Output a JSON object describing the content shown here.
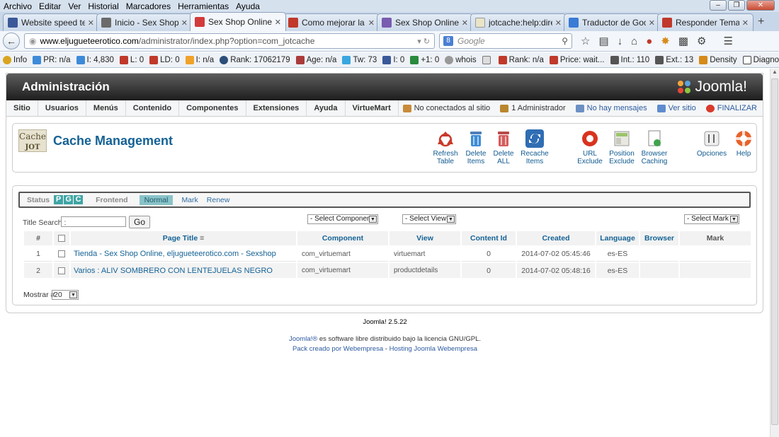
{
  "browser": {
    "menu": [
      "Archivo",
      "Editar",
      "Ver",
      "Historial",
      "Marcadores",
      "Herramientas",
      "Ayuda"
    ],
    "tabs": [
      {
        "title": "Website speed test",
        "color": "#3b5998"
      },
      {
        "title": "Inicio - Sex Shop ...",
        "color": "#6b6b6b"
      },
      {
        "title": "Sex Shop Online. ...",
        "color": "#d23b3b"
      },
      {
        "title": "Como mejorar la ...",
        "color": "#c0392b"
      },
      {
        "title": "Sex Shop Online. ...",
        "color": "#7a5cb0"
      },
      {
        "title": "jotcache:help:dire...",
        "color": "#f2f0e0"
      },
      {
        "title": "Traductor de Goo...",
        "color": "#3a7bd5"
      },
      {
        "title": "Responder Tema: ...",
        "color": "#c0392b"
      }
    ],
    "url_domain": "www.eljugueteerotico.com",
    "url_path": "/administrator/index.php?option=com_jotcache",
    "search_placeholder": "Google",
    "seo": [
      "Info",
      "PR: n/a",
      "I: 4,830",
      "L: 0",
      "LD: 0",
      "I: n/a",
      "Rank: 17062179",
      "Age: n/a",
      "Tw: 73",
      "I: 0",
      "+1: 0",
      "whois",
      "",
      "Rank: n/a",
      "Price: wait...",
      "Int.: 110",
      "Ext.: 13",
      "Density",
      "Diagnosis"
    ]
  },
  "admin": {
    "title": "Administración",
    "brand": "Joomla!",
    "menu": [
      "Sitio",
      "Usuarios",
      "Menús",
      "Contenido",
      "Componentes",
      "Extensiones",
      "Ayuda",
      "VirtueMart"
    ],
    "status": {
      "not_connected": "No conectados al sitio",
      "admins": "1 Administrador",
      "messages": "No hay mensajes",
      "view_site": "Ver sitio",
      "logout": "FINALIZAR"
    }
  },
  "toolbar": {
    "logo_line1": "Cache",
    "logo_line2": "JOT",
    "title": "Cache Management",
    "buttons": [
      {
        "l1": "Refresh",
        "l2": "Table"
      },
      {
        "l1": "Delete",
        "l2": "Items"
      },
      {
        "l1": "Delete",
        "l2": "ALL"
      },
      {
        "l1": "Recache",
        "l2": "Items"
      },
      {
        "l1": "URL",
        "l2": "Exclude"
      },
      {
        "l1": "Position",
        "l2": "Exclude"
      },
      {
        "l1": "Browser",
        "l2": "Caching"
      },
      {
        "l1": "Opciones",
        "l2": ""
      },
      {
        "l1": "Help",
        "l2": ""
      }
    ]
  },
  "filters": {
    "status_label": "Status",
    "pgc": [
      "P",
      "G",
      "C"
    ],
    "frontend": "Frontend",
    "normal": "Normal",
    "mark": "Mark",
    "renew": "Renew",
    "title_search_label": "Title Search :",
    "title_search_value": "",
    "go": "Go",
    "select_component": "- Select Component -",
    "select_view": "- Select View -",
    "select_mark": "- Select Mark -"
  },
  "table": {
    "headers": [
      "#",
      "",
      "Page Title",
      "Component",
      "View",
      "Content Id",
      "Created",
      "Language",
      "Browser",
      "Mark"
    ],
    "rows": [
      {
        "num": "1",
        "title": "Tienda - Sex Shop Online, eljugueteerotico.com - Sexshop",
        "component": "com_virtuemart",
        "view": "virtuemart",
        "content_id": "0",
        "created": "2014-07-02 05:45:46",
        "language": "es-ES",
        "browser": "",
        "mark": ""
      },
      {
        "num": "2",
        "title": "Varios : ALIV SOMBRERO CON LENTEJUELAS NEGRO",
        "component": "com_virtuemart",
        "view": "productdetails",
        "content_id": "0",
        "created": "2014-07-02 05:48:16",
        "language": "es-ES",
        "browser": "",
        "mark": ""
      }
    ]
  },
  "pager": {
    "label": "Mostrar #",
    "value": "20"
  },
  "footer": {
    "version": "Joomla! 2.5.22",
    "license_link": "Joomla!®",
    "license_text": " es software libre distribuido bajo la licencia GNU/GPL.",
    "pack_link1": "Pack creado por Webempresa",
    "sep": " - ",
    "pack_link2": "Hosting Joomla Webempresa"
  }
}
